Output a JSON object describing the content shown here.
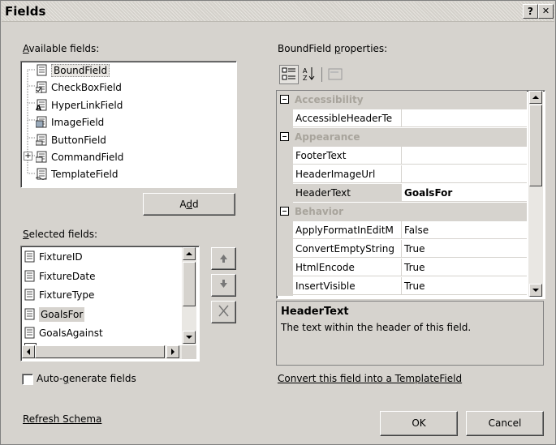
{
  "window": {
    "title": "Fields",
    "help_glyph": "?",
    "close_glyph": "✕"
  },
  "available": {
    "label_pre": "",
    "label_acc": "A",
    "label_post": "vailable fields:",
    "items": [
      {
        "label": "BoundField",
        "icon": "boundfield-icon"
      },
      {
        "label": "CheckBoxField",
        "icon": "checkboxfield-icon"
      },
      {
        "label": "HyperLinkField",
        "icon": "hyperlinkfield-icon"
      },
      {
        "label": "ImageField",
        "icon": "imagefield-icon"
      },
      {
        "label": "ButtonField",
        "icon": "buttonfield-icon"
      },
      {
        "label": "CommandField",
        "icon": "commandfield-icon"
      },
      {
        "label": "TemplateField",
        "icon": "templatefield-icon"
      }
    ],
    "expand_glyph": "+"
  },
  "add_button": {
    "pre": "A",
    "acc": "d",
    "post": "d"
  },
  "selected": {
    "label_pre": "",
    "label_acc": "S",
    "label_post": "elected fields:",
    "items": [
      "FixtureID",
      "FixtureDate",
      "FixtureType",
      "GoalsFor",
      "GoalsAgainst"
    ],
    "selected_index": 3
  },
  "move_up_glyph": "▲",
  "move_down_glyph": "▼",
  "delete_glyph": "✕",
  "autogen": {
    "pre": "Auto-",
    "acc": "g",
    "post": "enerate fields",
    "checked": false
  },
  "refresh_schema": "Refresh Schema",
  "props": {
    "label_pre": "BoundField ",
    "label_acc": "p",
    "label_post": "roperties:",
    "toolbar": {
      "categorized_icon": "categorized-icon",
      "alpha_icon": "alphabetical-icon",
      "pages_icon": "property-pages-icon",
      "alpha_text": "A Z↓"
    },
    "collapse_glyph": "⊟",
    "rows": [
      {
        "type": "category",
        "name": "Accessibility"
      },
      {
        "type": "prop",
        "name": "AccessibleHeaderTe",
        "value": ""
      },
      {
        "type": "category",
        "name": "Appearance"
      },
      {
        "type": "prop",
        "name": "FooterText",
        "value": ""
      },
      {
        "type": "prop",
        "name": "HeaderImageUrl",
        "value": ""
      },
      {
        "type": "prop",
        "name": "HeaderText",
        "value": "GoalsFor",
        "bold": true
      },
      {
        "type": "category",
        "name": "Behavior"
      },
      {
        "type": "prop",
        "name": "ApplyFormatInEditM",
        "value": "False"
      },
      {
        "type": "prop",
        "name": "ConvertEmptyString",
        "value": "True"
      },
      {
        "type": "prop",
        "name": "HtmlEncode",
        "value": "True"
      },
      {
        "type": "prop",
        "name": "InsertVisible",
        "value": "True"
      }
    ],
    "description": {
      "title": "HeaderText",
      "text": "The text within the header of this field."
    }
  },
  "convert_link": "Convert this field into a TemplateField",
  "ok_label": "OK",
  "cancel_label": "Cancel",
  "colors": {
    "dialog": "#d6d3ce",
    "selection": "#d6d3ce",
    "category_text": "#a8a49c"
  }
}
